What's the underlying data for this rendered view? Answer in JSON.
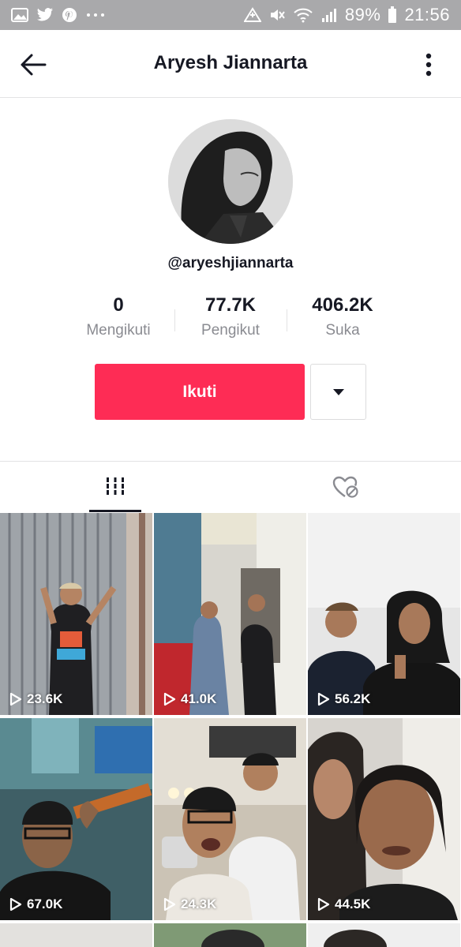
{
  "status_bar": {
    "battery": "89%",
    "time": "21:56"
  },
  "header": {
    "title": "Aryesh Jiannarta"
  },
  "profile": {
    "handle": "@aryeshjiannarta",
    "stats": [
      {
        "value": "0",
        "label": "Mengikuti"
      },
      {
        "value": "77.7K",
        "label": "Pengikut"
      },
      {
        "value": "406.2K",
        "label": "Suka"
      }
    ],
    "follow_label": "Ikuti"
  },
  "tabs": [
    {
      "icon": "grid-icon",
      "selected": true
    },
    {
      "icon": "liked-private-icon",
      "selected": false
    }
  ],
  "videos": [
    {
      "views": "23.6K"
    },
    {
      "views": "41.0K"
    },
    {
      "views": "56.2K"
    },
    {
      "views": "67.0K"
    },
    {
      "views": "24.3K"
    },
    {
      "views": "44.5K"
    }
  ],
  "colors": {
    "accent": "#fe2c55",
    "text": "#161823",
    "muted": "#8a8b91"
  }
}
